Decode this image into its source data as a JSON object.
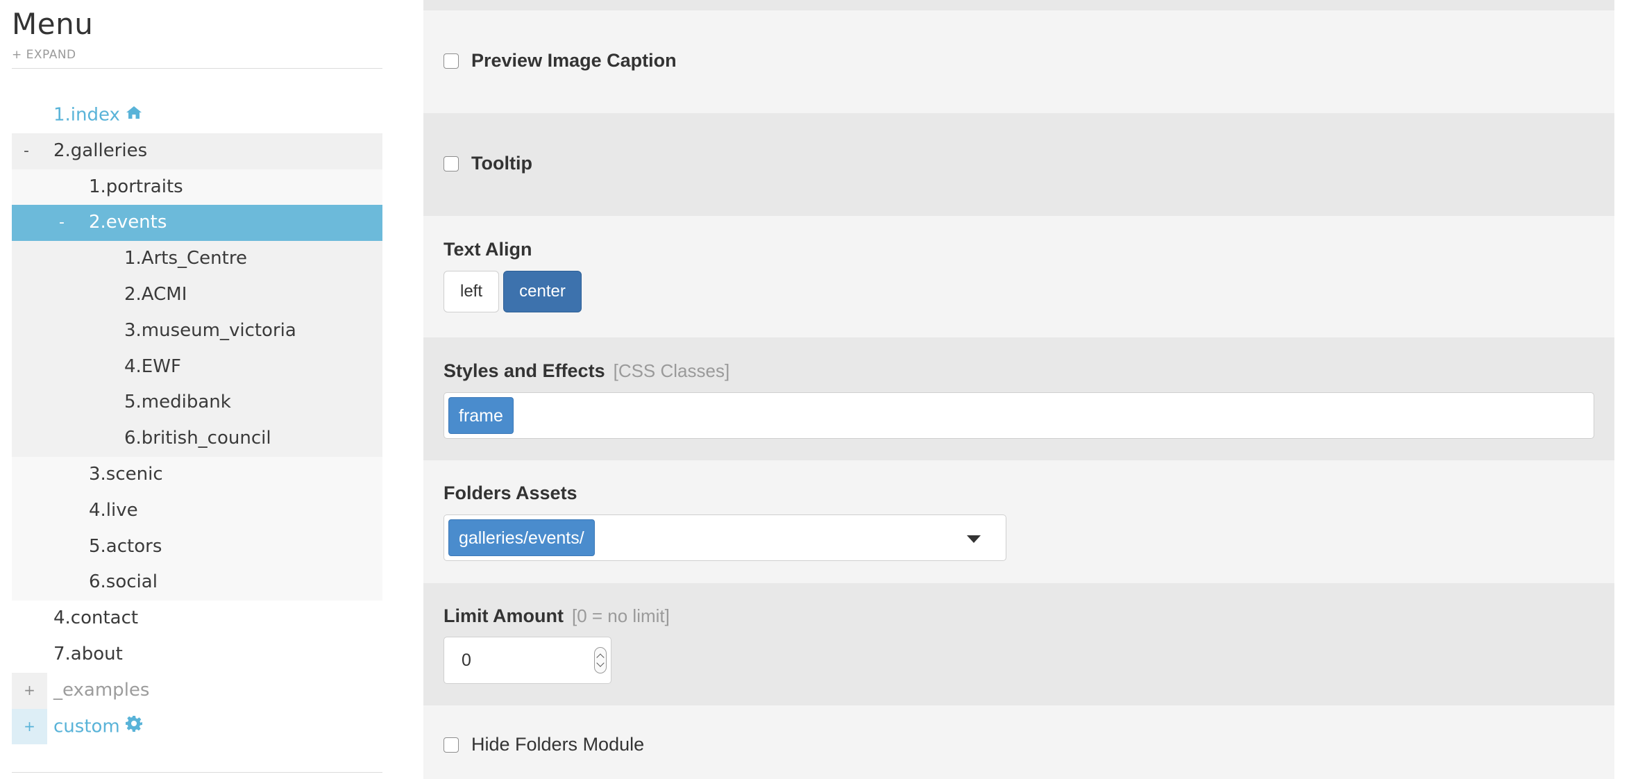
{
  "sidebar": {
    "title": "Menu",
    "expand": "+ EXPAND",
    "items": [
      {
        "label": "1.index",
        "toggle": "",
        "icon": "home-icon"
      },
      {
        "label": "2.galleries",
        "toggle": "-"
      },
      {
        "label": "1.portraits",
        "toggle": ""
      },
      {
        "label": "2.events",
        "toggle": "-",
        "active": true
      },
      {
        "label": "1.Arts_Centre"
      },
      {
        "label": "2.ACMI"
      },
      {
        "label": "3.museum_victoria"
      },
      {
        "label": "4.EWF"
      },
      {
        "label": "5.medibank"
      },
      {
        "label": "6.british_council"
      },
      {
        "label": "3.scenic"
      },
      {
        "label": "4.live"
      },
      {
        "label": "5.actors"
      },
      {
        "label": "6.social"
      },
      {
        "label": "4.contact"
      },
      {
        "label": "7.about"
      },
      {
        "label": "_examples",
        "toggle": "+"
      },
      {
        "label": "custom",
        "toggle": "+",
        "icon": "gear-icon"
      }
    ]
  },
  "form": {
    "preview_caption": {
      "label": "Preview Image Caption",
      "checked": false
    },
    "tooltip": {
      "label": "Tooltip",
      "checked": false
    },
    "text_align": {
      "label": "Text Align",
      "options": [
        "left",
        "center"
      ],
      "selected": "center"
    },
    "styles": {
      "label": "Styles and Effects",
      "hint": "[CSS Classes]",
      "tags": [
        "frame"
      ]
    },
    "folders": {
      "label": "Folders Assets",
      "tags": [
        "galleries/events/"
      ]
    },
    "limit": {
      "label": "Limit Amount",
      "hint": "[0 = no limit]",
      "value": "0"
    },
    "hide_folders": {
      "label": "Hide Folders Module",
      "checked": false
    }
  },
  "colors": {
    "accent": "#59b3d8",
    "active_row": "#6cbada",
    "primary_button": "#3d72ad",
    "tag": "#4a8ccd"
  }
}
